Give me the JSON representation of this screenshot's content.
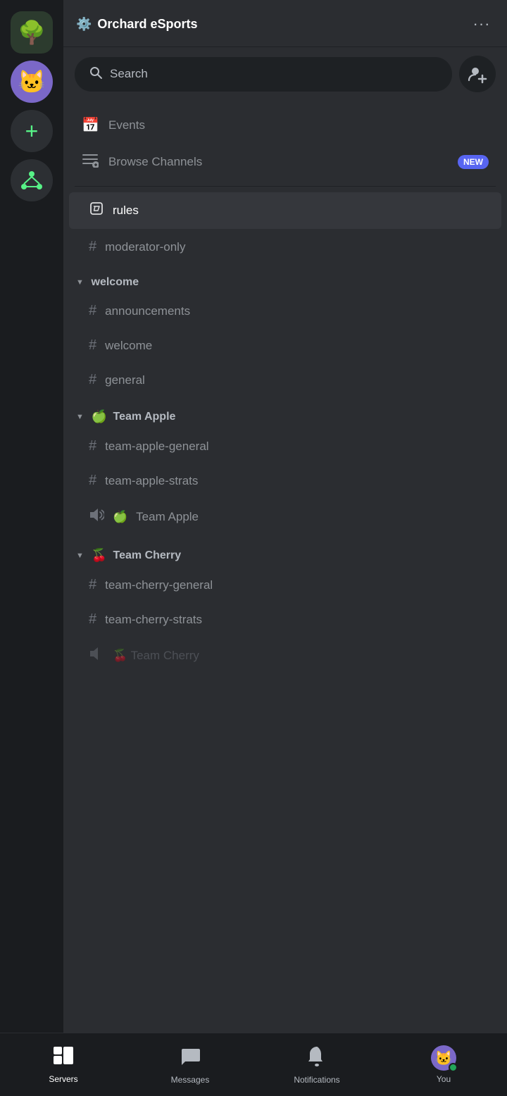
{
  "app": {
    "server_name": "Orchard eSports",
    "search_placeholder": "Search"
  },
  "server_icons": [
    {
      "id": "orchard",
      "emoji": "🌳",
      "label": "Orchard eSports"
    },
    {
      "id": "cat",
      "emoji": "🐱",
      "label": "Cat Server"
    }
  ],
  "menu_items": [
    {
      "id": "events",
      "icon": "📅",
      "label": "Events"
    },
    {
      "id": "browse",
      "icon": "≡◎",
      "label": "Browse Channels",
      "badge": "NEW"
    }
  ],
  "channels": {
    "uncategorized": [
      {
        "id": "rules",
        "name": "rules",
        "active": true,
        "icon": "rules"
      },
      {
        "id": "moderator-only",
        "name": "moderator-only",
        "active": false
      }
    ],
    "categories": [
      {
        "id": "welcome",
        "name": "welcome",
        "emoji": "",
        "channels": [
          {
            "id": "announcements",
            "name": "announcements"
          },
          {
            "id": "welcome-ch",
            "name": "welcome"
          },
          {
            "id": "general",
            "name": "general"
          }
        ]
      },
      {
        "id": "team-apple",
        "name": "Team Apple",
        "emoji": "🍏",
        "channels": [
          {
            "id": "team-apple-general",
            "name": "team-apple-general",
            "type": "text"
          },
          {
            "id": "team-apple-strats",
            "name": "team-apple-strats",
            "type": "text"
          },
          {
            "id": "team-apple-voice",
            "name": "Team Apple",
            "type": "voice",
            "emoji": "🍏"
          }
        ]
      },
      {
        "id": "team-cherry",
        "name": "Team Cherry",
        "emoji": "🍒",
        "channels": [
          {
            "id": "team-cherry-general",
            "name": "team-cherry-general",
            "type": "text"
          },
          {
            "id": "team-cherry-strats",
            "name": "team-cherry-strats",
            "type": "text"
          }
        ]
      }
    ]
  },
  "bottom_nav": [
    {
      "id": "servers",
      "label": "Servers",
      "icon": "servers",
      "active": true
    },
    {
      "id": "messages",
      "label": "Messages",
      "icon": "messages",
      "active": false
    },
    {
      "id": "notifications",
      "label": "Notifications",
      "icon": "notifications",
      "active": false
    },
    {
      "id": "you",
      "label": "You",
      "icon": "avatar",
      "active": false
    }
  ]
}
